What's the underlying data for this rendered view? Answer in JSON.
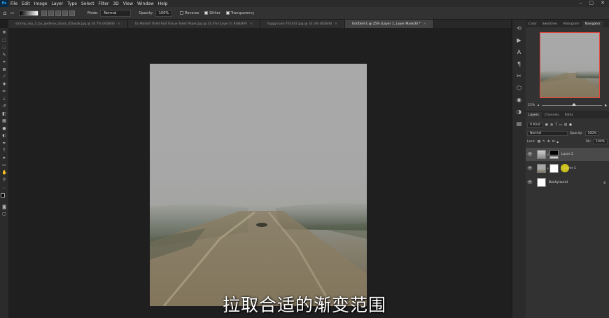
{
  "menubar": {
    "logo": "Ps",
    "items": [
      "File",
      "Edit",
      "Image",
      "Layer",
      "Type",
      "Select",
      "Filter",
      "3D",
      "View",
      "Window",
      "Help"
    ]
  },
  "options": {
    "mode_label": "Mode:",
    "mode_value": "Normal",
    "opacity_label": "Opacity:",
    "opacity_value": "100%",
    "reverse_label": "Reverse",
    "dither_label": "Dither",
    "transparency_label": "Transparency"
  },
  "tabs": [
    {
      "label": "stormy_sky_3_by_pederus_stock_d2lasdk.jpg @ 16.7% (RGB/8)",
      "active": false
    },
    {
      "label": "Us Market Toilet Roll Tissue Toilet Paper.jpg @ 33.3% (Layer 0, RGB/8#)",
      "active": false
    },
    {
      "label": "foggy-road-701447.jpg @ 33.3% (RGB/8)",
      "active": false
    },
    {
      "label": "Untitled-1 @ 25% (Layer 1, Layer Mask/8) *",
      "active": true
    }
  ],
  "navigator": {
    "tabs": [
      "Color",
      "Swatches",
      "Histogram",
      "Navigator"
    ],
    "active_tab": "Navigator",
    "zoom": "25%"
  },
  "layers": {
    "tabs": [
      "Layers",
      "Channels",
      "Paths"
    ],
    "active_tab": "Layers",
    "kind_label": "Kind",
    "blend_mode": "Normal",
    "opacity_label": "Opacity:",
    "opacity_value": "100%",
    "lock_label": "Lock:",
    "fill_label": "Fill:",
    "fill_value": "100%",
    "items": [
      {
        "name": "Layer 2",
        "selected": true,
        "locked": false
      },
      {
        "name": "Layer 1",
        "selected": false,
        "locked": false
      },
      {
        "name": "Background",
        "selected": false,
        "locked": true
      }
    ]
  },
  "subtitle": "拉取合适的渐变范围",
  "colors": {
    "panel_bg": "#323232",
    "app_bg": "#1e1e1e",
    "nav_frame": "#e8453c",
    "cursor": "#e6dc1e"
  }
}
